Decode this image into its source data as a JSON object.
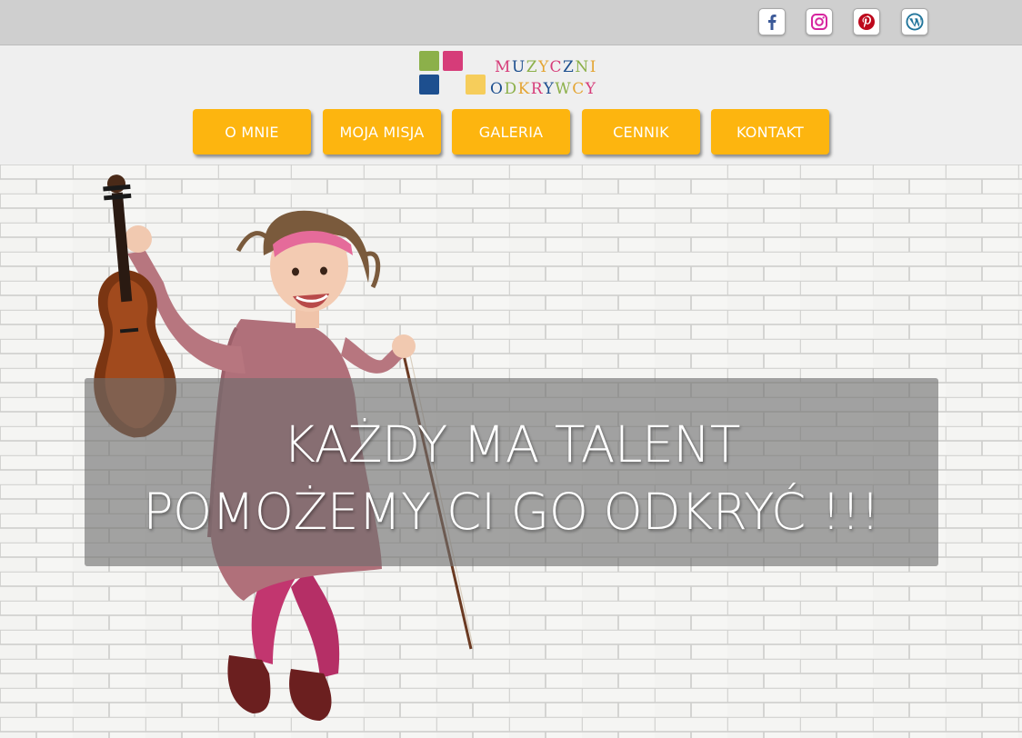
{
  "social": {
    "items": [
      {
        "name": "facebook-icon",
        "color": "#3b5998"
      },
      {
        "name": "instagram-icon",
        "color": "#d6249f"
      },
      {
        "name": "pinterest-icon",
        "color": "#bd081c"
      },
      {
        "name": "wordpress-icon",
        "color": "#21759b"
      }
    ]
  },
  "logo": {
    "line1": [
      "M",
      "U",
      "Z",
      "Y",
      "C",
      "Z",
      "N",
      "I"
    ],
    "line2": [
      "O",
      "D",
      "K",
      "R",
      "Y",
      "W",
      "C",
      "Y"
    ],
    "squares": [
      "#8cb04a",
      "#d63c79",
      "#1d4f8f",
      "#f6cd5b"
    ],
    "letter_colors": [
      "#d63c79",
      "#1d4f8f",
      "#8cb04a",
      "#e4a533"
    ]
  },
  "nav": {
    "items": [
      {
        "label": "O MNIE"
      },
      {
        "label": "MOJA MISJA"
      },
      {
        "label": "GALERIA"
      },
      {
        "label": "CENNIK"
      },
      {
        "label": "KONTAKT"
      }
    ],
    "accent": "#fdb50f"
  },
  "hero": {
    "line1": "KAŻDY MA TALENT",
    "line2": "POMOŻEMY CI GO ODKRYĆ !!!"
  }
}
